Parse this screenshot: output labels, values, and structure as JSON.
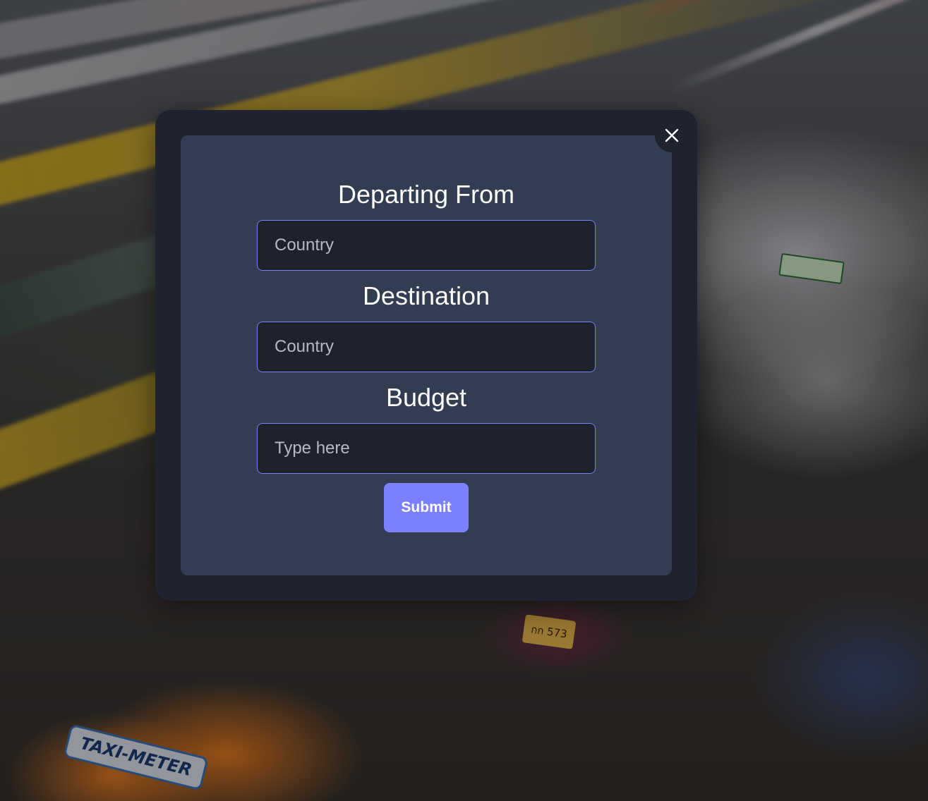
{
  "background": {
    "taxi_sign": "TAXI-METER",
    "plate_text": "กก 573"
  },
  "modal": {
    "close_icon": "close-icon",
    "departing": {
      "label": "Departing From",
      "placeholder": "Country",
      "value": ""
    },
    "destination": {
      "label": "Destination",
      "placeholder": "Country",
      "value": ""
    },
    "budget": {
      "label": "Budget",
      "placeholder": "Type here",
      "value": ""
    },
    "submit_label": "Submit"
  },
  "colors": {
    "accent": "#7c7fff",
    "modal_outer": "#1f2330",
    "modal_inner": "#323d52",
    "input_bg": "#1e222e",
    "input_border": "#7b7ff0"
  }
}
